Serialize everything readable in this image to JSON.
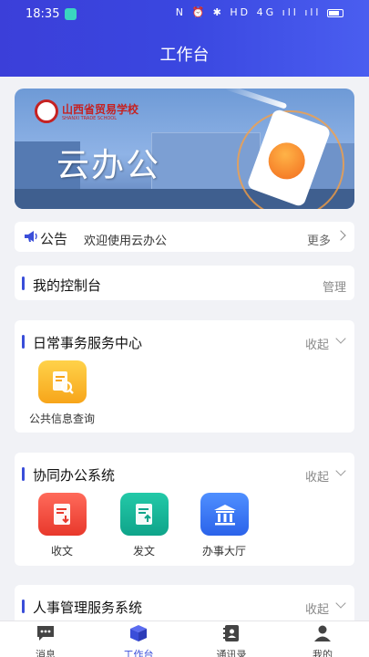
{
  "status_bar": {
    "time": "18:35",
    "indicators": "N ⏰ ✱ HD 4G ıll ıll"
  },
  "header": {
    "title": "工作台"
  },
  "banner": {
    "school_name": "山西省贸易学校",
    "school_name_en": "SHANXI TRADE SCHOOL",
    "headline": "云办公"
  },
  "notice": {
    "label": "公告",
    "text": "欢迎使用云办公",
    "more": "更多"
  },
  "console": {
    "title": "我的控制台",
    "action": "管理"
  },
  "daily": {
    "title": "日常事务服务中心",
    "action": "收起",
    "apps": [
      {
        "label": "公共信息查询",
        "icon": "search-document-icon"
      }
    ]
  },
  "collab": {
    "title": "协同办公系统",
    "action": "收起",
    "apps": [
      {
        "label": "收文",
        "icon": "inbox-document-icon"
      },
      {
        "label": "发文",
        "icon": "send-document-icon"
      },
      {
        "label": "办事大厅",
        "icon": "bank-hall-icon"
      }
    ]
  },
  "hr": {
    "title": "人事管理服务系统",
    "action": "收起"
  },
  "tabbar": {
    "items": [
      {
        "label": "消息",
        "icon": "message-icon"
      },
      {
        "label": "工作台",
        "icon": "cube-icon",
        "active": true
      },
      {
        "label": "通讯录",
        "icon": "contacts-icon"
      },
      {
        "label": "我的",
        "icon": "person-icon"
      }
    ]
  },
  "colors": {
    "accent": "#3a4ed9",
    "header_start": "#3b3fd9",
    "header_end": "#4a5ef0"
  }
}
